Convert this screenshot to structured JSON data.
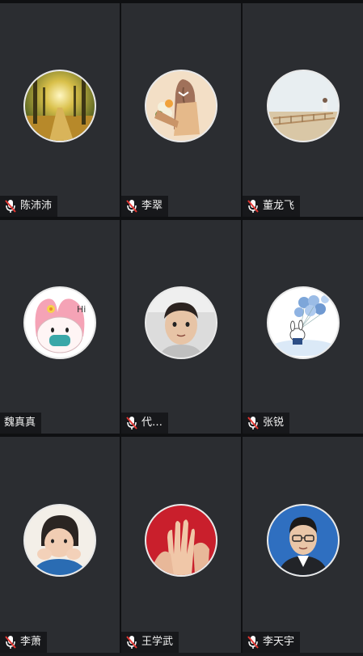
{
  "participants": [
    {
      "name": "陈沛沛",
      "mic": "muted",
      "avatar": "forest-path-photo"
    },
    {
      "name": "李翠",
      "mic": "muted",
      "avatar": "bouquet-illustration"
    },
    {
      "name": "董龙飞",
      "mic": "muted",
      "avatar": "boardwalk-photo"
    },
    {
      "name": "魏真真",
      "mic": "none",
      "avatar": "my-melody-mask-cartoon"
    },
    {
      "name": "代…",
      "mic": "muted",
      "avatar": "child-portrait-photo"
    },
    {
      "name": "张锐",
      "mic": "muted",
      "avatar": "balloon-bunny-cartoon"
    },
    {
      "name": "李萧",
      "mic": "muted",
      "avatar": "child-hands-face-photo"
    },
    {
      "name": "王学武",
      "mic": "muted",
      "avatar": "hands-photo"
    },
    {
      "name": "李天宇",
      "mic": "muted",
      "avatar": "man-glasses-portrait"
    }
  ],
  "colors": {
    "tile": "#2b2d31",
    "mic_muted": "#e53935",
    "label_text": "#f2f2f2"
  }
}
